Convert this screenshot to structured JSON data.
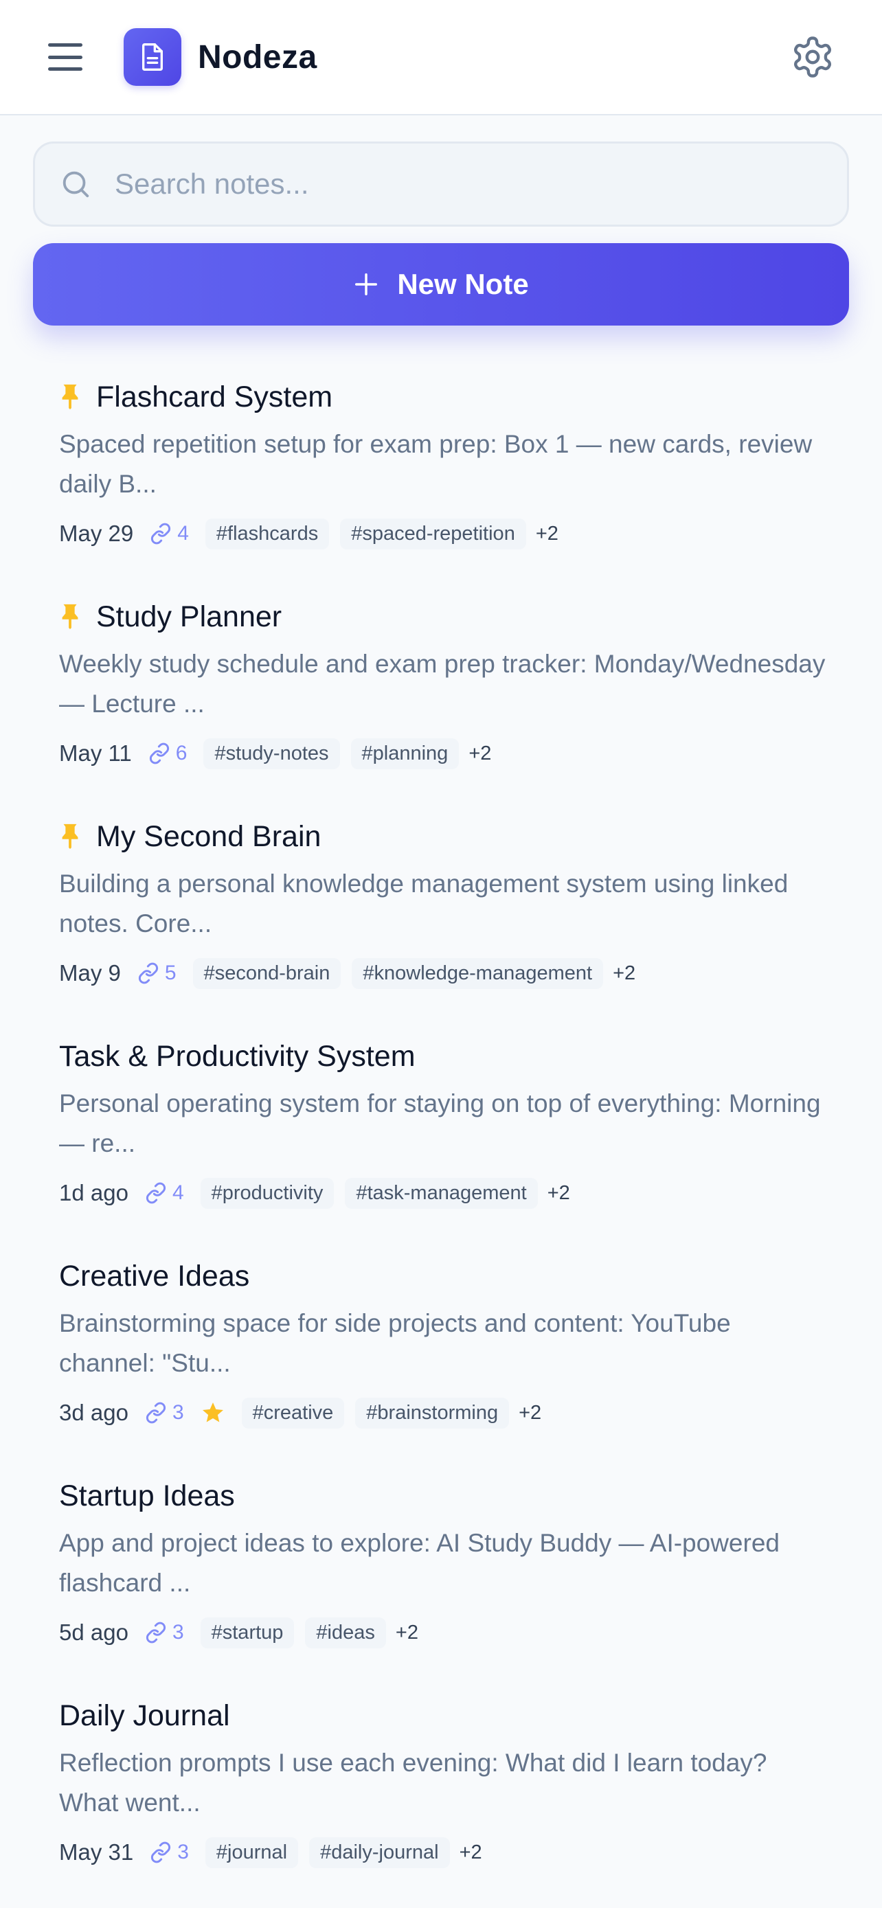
{
  "header": {
    "brand": "Nodeza",
    "menu_icon": "hamburger-menu-icon",
    "logo_icon": "document-icon",
    "settings_icon": "gear-icon",
    "accent": "#4f46e5"
  },
  "search": {
    "placeholder": "Search notes...",
    "value": ""
  },
  "new_note": {
    "label": "New Note"
  },
  "notes": [
    {
      "title": "Flashcard System",
      "pinned": true,
      "preview": "Spaced repetition setup for exam prep: Box 1 — new cards, review daily B...",
      "date": "May 29",
      "links": "4",
      "tags": [
        "#flashcards",
        "#spaced-repetition"
      ],
      "more": "+2"
    },
    {
      "title": "Study Planner",
      "pinned": true,
      "preview": "Weekly study schedule and exam prep tracker: Monday/Wednesday — Lecture ...",
      "date": "May 11",
      "links": "6",
      "tags": [
        "#study-notes",
        "#planning"
      ],
      "more": "+2"
    },
    {
      "title": "My Second Brain",
      "pinned": true,
      "preview": "Building a personal knowledge management system using linked notes. Core...",
      "date": "May 9",
      "links": "5",
      "tags": [
        "#second-brain",
        "#knowledge-management"
      ],
      "more": "+2"
    },
    {
      "title": "Task & Productivity System",
      "pinned": false,
      "preview": "Personal operating system for staying on top of everything: Morning — re...",
      "date": "1d ago",
      "links": "4",
      "tags": [
        "#productivity",
        "#task-management"
      ],
      "more": "+2"
    },
    {
      "title": "Creative Ideas",
      "pinned": false,
      "starred": true,
      "preview": "Brainstorming space for side projects and content: YouTube channel: \"Stu...",
      "date": "3d ago",
      "links": "3",
      "tags": [
        "#creative",
        "#brainstorming"
      ],
      "more": "+2"
    },
    {
      "title": "Startup Ideas",
      "pinned": false,
      "preview": "App and project ideas to explore: AI Study Buddy — AI-powered flashcard ...",
      "date": "5d ago",
      "links": "3",
      "tags": [
        "#startup",
        "#ideas"
      ],
      "more": "+2"
    },
    {
      "title": "Daily Journal",
      "pinned": false,
      "preview": "Reflection prompts I use each evening: What did I learn today? What went...",
      "date": "May 31",
      "links": "3",
      "tags": [
        "#journal",
        "#daily-journal"
      ],
      "more": "+2"
    }
  ]
}
